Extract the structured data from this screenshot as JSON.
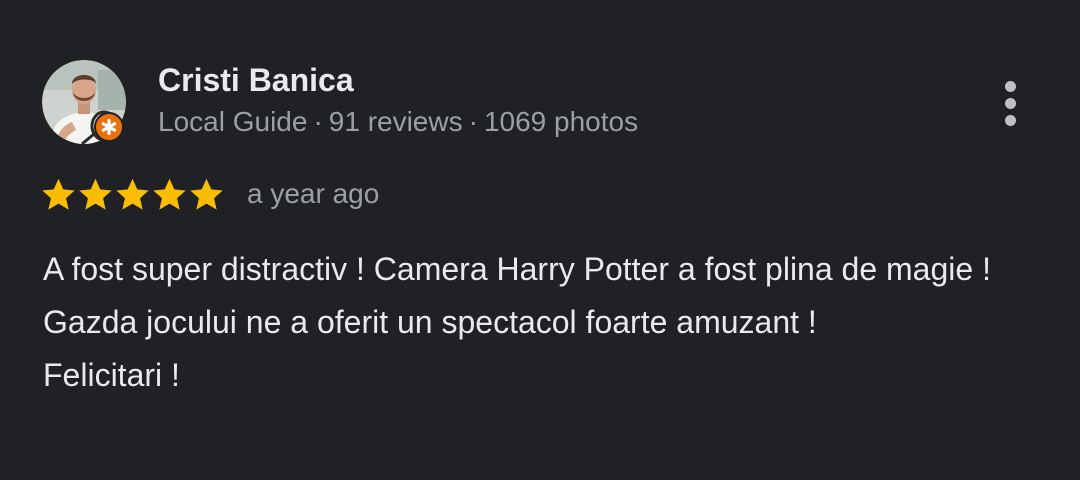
{
  "review": {
    "author_name": "Cristi Banica",
    "author_meta": {
      "role": "Local Guide",
      "separator": "·",
      "reviews": "91 reviews",
      "photos": "1069 photos"
    },
    "rating": 5,
    "rating_max": 5,
    "date": "a year ago",
    "text_lines": [
      "A fost super distractiv ! Camera Harry Potter a fost plina de magie !",
      "Gazda jocului ne a oferit un spectacol foarte amuzant !",
      "Felicitari !"
    ]
  },
  "icons": {
    "avatar": "profile-photo",
    "badge": "local-guide-badge-icon",
    "more": "more-vert-icon",
    "star": "star-icon"
  },
  "colors": {
    "background": "#202124",
    "primary_text": "#e8eaed",
    "secondary_text": "#9aa0a6",
    "star": "#fbbc04",
    "badge": "#e8710a"
  }
}
